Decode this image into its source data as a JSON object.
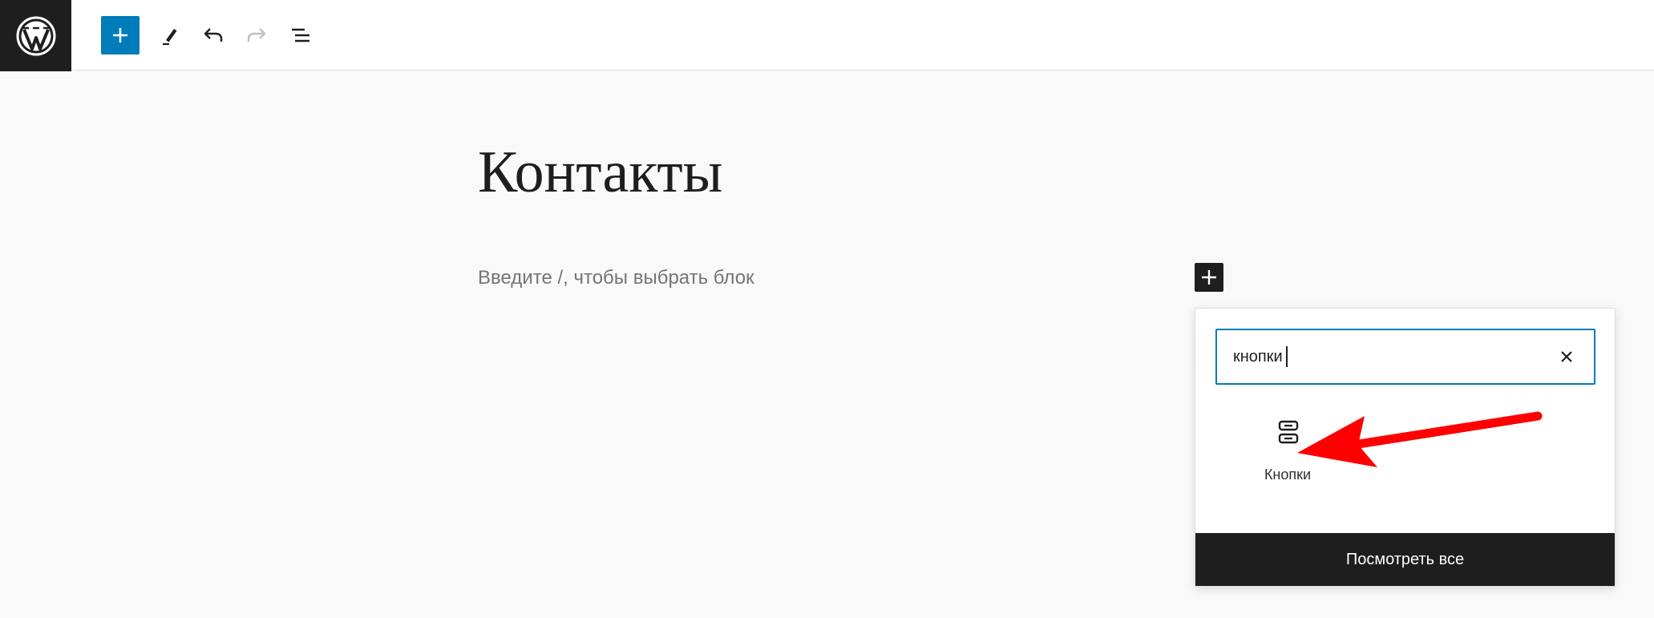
{
  "toolbar": {
    "logo_icon": "wordpress-logo-icon",
    "add_block_icon": "plus-icon",
    "tools_icon": "pencil-icon",
    "undo_icon": "undo-icon",
    "redo_icon": "redo-icon",
    "document_overview_icon": "list-view-icon"
  },
  "editor": {
    "title": "Контакты",
    "block_placeholder": "Введите /, чтобы выбрать блок"
  },
  "inserter": {
    "search_value": "кнопки",
    "clear_icon": "close-icon",
    "results": [
      {
        "label": "Кнопки",
        "icon": "buttons-block-icon"
      }
    ],
    "view_all_label": "Посмотреть все"
  },
  "annotation": {
    "arrow_color": "#ff0000"
  },
  "colors": {
    "accent": "#007cba",
    "dark": "#1e1e1e",
    "background": "#f9f9f9"
  }
}
